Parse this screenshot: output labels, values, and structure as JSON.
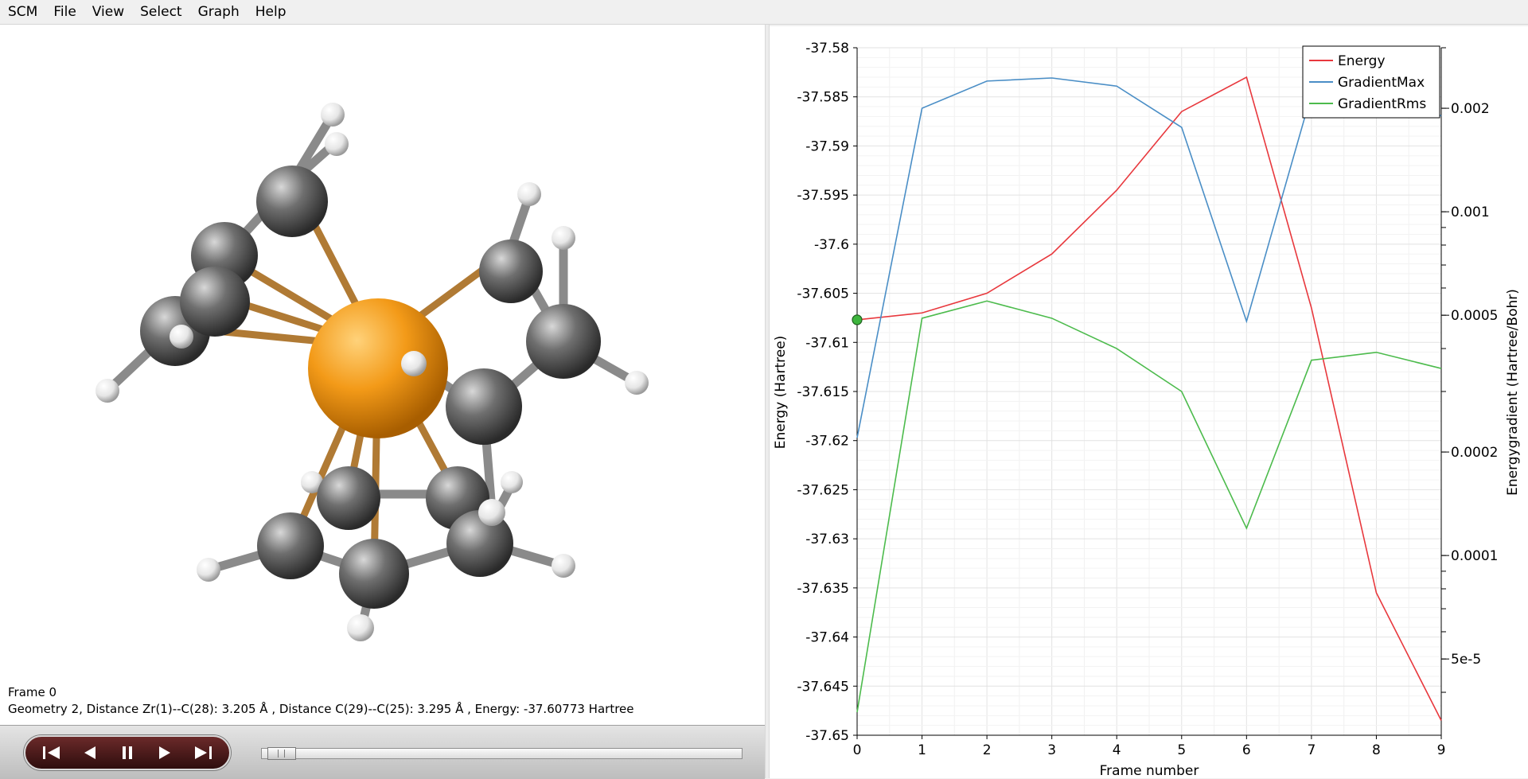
{
  "menu": [
    "SCM",
    "File",
    "View",
    "Select",
    "Graph",
    "Help"
  ],
  "status": {
    "frame": "Frame 0",
    "info": "Geometry 2, Distance Zr(1)--C(28): 3.205 Å , Distance C(29)--C(25): 3.295 Å , Energy: -37.60773 Hartree"
  },
  "player": {
    "buttons": [
      "first-frame",
      "previous-frame",
      "pause",
      "next-frame",
      "last-frame"
    ],
    "slider_position": 0
  },
  "colors": {
    "energy": "#e8383d",
    "gradient_max": "#4a8ec6",
    "gradient_rms": "#4cbb4c",
    "zr_atom": "#f5a020",
    "bond": "#b07a34"
  },
  "chart_data": {
    "type": "line",
    "xlabel": "Frame number",
    "ylabel": "Energy (Hartree)",
    "y2label": "Energygradient (Hartree/Bohr)",
    "x": [
      0,
      1,
      2,
      3,
      4,
      5,
      6,
      7,
      8,
      9
    ],
    "xlim": [
      0,
      9
    ],
    "ylim": [
      -37.65,
      -37.58
    ],
    "y_ticks": [
      "-37.58",
      "-37.585",
      "-37.59",
      "-37.595",
      "-37.6",
      "-37.605",
      "-37.61",
      "-37.615",
      "-37.62",
      "-37.625",
      "-37.63",
      "-37.635",
      "-37.64",
      "-37.645",
      "-37.65"
    ],
    "y2_scale": "log",
    "y2lim": [
      3e-05,
      0.003
    ],
    "y2_ticks": [
      "0.002",
      "0.001",
      "0.0005",
      "0.0002",
      "0.0001",
      "5e-5"
    ],
    "legend_position": "top-right",
    "grid": true,
    "series": [
      {
        "name": "Energy",
        "axis": "left",
        "values": [
          -37.6077,
          -37.607,
          -37.605,
          -37.601,
          -37.5945,
          -37.5865,
          -37.583,
          -37.6065,
          -37.6355,
          -37.6485
        ]
      },
      {
        "name": "GradientMax",
        "axis": "right",
        "values": [
          0.00022,
          0.002,
          0.0024,
          0.00245,
          0.00232,
          0.00176,
          0.00048,
          0.0022,
          0.00235,
          0.0019
        ]
      },
      {
        "name": "GradientRms",
        "axis": "right",
        "values": [
          3.5e-05,
          0.00049,
          0.00055,
          0.00049,
          0.0004,
          0.0003,
          0.00012,
          0.00037,
          0.00039,
          0.00035
        ]
      }
    ],
    "marker": {
      "x": 0,
      "series": "Energy"
    }
  }
}
